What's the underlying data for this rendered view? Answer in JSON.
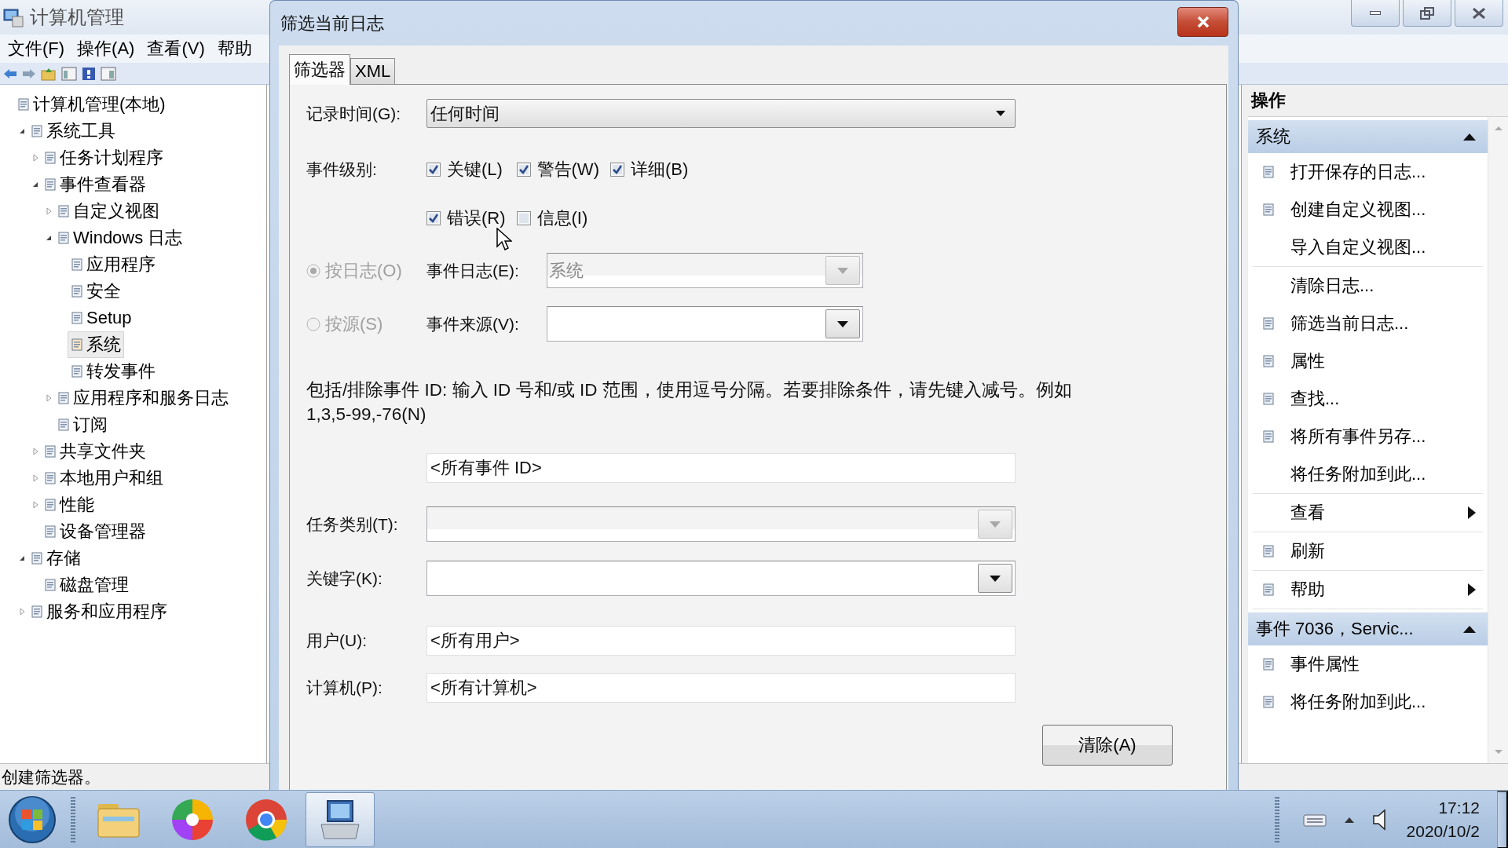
{
  "window": {
    "title": "计算机管理",
    "menu": [
      "文件(F)",
      "操作(A)",
      "查看(V)",
      "帮助"
    ]
  },
  "tree": [
    {
      "label": "计算机管理(本地)",
      "selected": false,
      "children": [
        {
          "label": "系统工具",
          "selected": false,
          "expanded": true,
          "children": [
            {
              "label": "任务计划程序",
              "selected": false,
              "expanded": false
            },
            {
              "label": "事件查看器",
              "selected": false,
              "expanded": true,
              "children": [
                {
                  "label": "自定义视图",
                  "selected": false,
                  "expanded": false
                },
                {
                  "label": "Windows 日志",
                  "selected": false,
                  "expanded": true,
                  "children": [
                    {
                      "label": "应用程序",
                      "selected": false
                    },
                    {
                      "label": "安全",
                      "selected": false
                    },
                    {
                      "label": "Setup",
                      "selected": false
                    },
                    {
                      "label": "系统",
                      "selected": true
                    },
                    {
                      "label": "转发事件",
                      "selected": false
                    }
                  ]
                },
                {
                  "label": "应用程序和服务日志",
                  "selected": false,
                  "expanded": false
                },
                {
                  "label": "订阅",
                  "selected": false
                }
              ]
            },
            {
              "label": "共享文件夹",
              "selected": false,
              "expanded": false
            },
            {
              "label": "本地用户和组",
              "selected": false,
              "expanded": false
            },
            {
              "label": "性能",
              "selected": false,
              "expanded": false
            },
            {
              "label": "设备管理器",
              "selected": false
            }
          ]
        },
        {
          "label": "存储",
          "selected": false,
          "expanded": true,
          "children": [
            {
              "label": "磁盘管理",
              "selected": false
            }
          ]
        },
        {
          "label": "服务和应用程序",
          "selected": false,
          "expanded": false
        }
      ]
    }
  ],
  "actions": {
    "title": "操作",
    "sections": [
      {
        "title": "系统",
        "expanded": true,
        "groups": [
          [
            {
              "label": "打开保存的日志...",
              "has_icon": true,
              "submenu": false
            },
            {
              "label": "创建自定义视图...",
              "has_icon": true,
              "submenu": false
            },
            {
              "label": "导入自定义视图...",
              "has_icon": false,
              "submenu": false
            }
          ],
          [
            {
              "label": "清除日志...",
              "has_icon": false,
              "submenu": false
            },
            {
              "label": "筛选当前日志...",
              "has_icon": true,
              "submenu": false
            },
            {
              "label": "属性",
              "has_icon": true,
              "submenu": false
            },
            {
              "label": "查找...",
              "has_icon": true,
              "submenu": false
            },
            {
              "label": "将所有事件另存...",
              "has_icon": true,
              "submenu": false
            },
            {
              "label": "将任务附加到此...",
              "has_icon": false,
              "submenu": false
            }
          ],
          [
            {
              "label": "查看",
              "has_icon": false,
              "submenu": true
            }
          ],
          [
            {
              "label": "刷新",
              "has_icon": true,
              "submenu": false
            }
          ],
          [
            {
              "label": "帮助",
              "has_icon": true,
              "submenu": true
            }
          ]
        ]
      },
      {
        "title": "事件 7036，Servic...",
        "expanded": true,
        "groups": [
          [
            {
              "label": "事件属性",
              "has_icon": true,
              "submenu": false
            },
            {
              "label": "将任务附加到此...",
              "has_icon": true,
              "submenu": false
            }
          ]
        ]
      }
    ]
  },
  "status_bar": "创建筛选器。",
  "dialog": {
    "title": "筛选当前日志",
    "tabs": [
      {
        "label": "筛选器",
        "selected": true
      },
      {
        "label": "XML",
        "selected": false
      }
    ],
    "logged": {
      "label": "记录时间(G):",
      "value": "任何时间"
    },
    "event_level": {
      "label": "事件级别:",
      "options": [
        {
          "label": "关键(L)",
          "checked": true
        },
        {
          "label": "警告(W)",
          "checked": true
        },
        {
          "label": "详细(B)",
          "checked": true
        },
        {
          "label": "错误(R)",
          "checked": true
        },
        {
          "label": "信息(I)",
          "checked": false
        }
      ]
    },
    "source_mode": [
      {
        "label": "按日志(O)",
        "selected": true,
        "disabled": true,
        "field_label": "事件日志(E):",
        "value": "系统",
        "field_disabled": true
      },
      {
        "label": "按源(S)",
        "selected": false,
        "disabled": true,
        "field_label": "事件来源(V):",
        "field_disabled": false
      }
    ],
    "event_ids": {
      "description": "包括/排除事件 ID: 输入 ID 号和/或 ID 范围，使用逗号分隔。若要排除条件，请先键入减号。例如\n1,3,5-99,-76(N)",
      "value": "<所有事件 ID>"
    },
    "task_category": {
      "label": "任务类别(T):",
      "disabled": true
    },
    "keywords": {
      "label": "关键字(K):",
      "disabled": false
    },
    "user": {
      "label": "用户(U):",
      "value": "<所有用户>"
    },
    "computer": {
      "label": "计算机(P):",
      "value": "<所有计算机>"
    },
    "clear_button": "清除(A)"
  },
  "taskbar": {
    "apps": [
      {
        "kind": "folder",
        "selected": false
      },
      {
        "kind": "pinwheel",
        "selected": false
      },
      {
        "kind": "browser",
        "selected": false
      },
      {
        "kind": "computer",
        "selected": true
      }
    ],
    "clock": {
      "time": "17:12",
      "date": "2020/10/2"
    }
  }
}
